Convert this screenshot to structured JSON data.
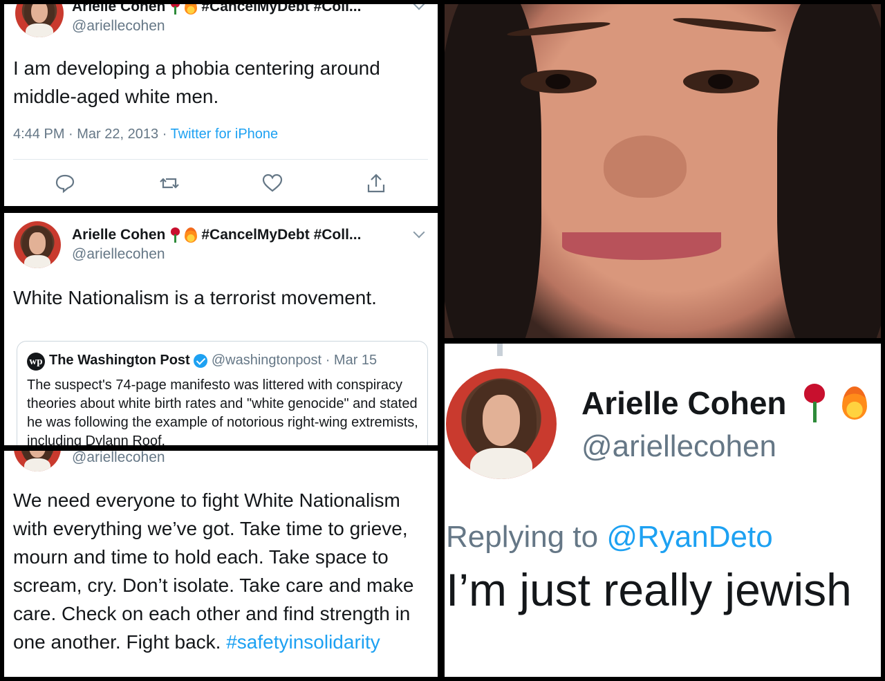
{
  "tweet1": {
    "name": "Arielle Cohen",
    "hashtags": "#CancelMyDebt #Coll...",
    "handle": "@ariellecohen",
    "text": "I am developing a phobia centering around middle-aged white men.",
    "time": "4:44 PM",
    "date": "Mar 22, 2013",
    "source": "Twitter for iPhone",
    "icons": [
      "reply-icon",
      "retweet-icon",
      "like-icon",
      "share-icon"
    ]
  },
  "tweet2": {
    "name": "Arielle Cohen",
    "hashtags": "#CancelMyDebt #Coll...",
    "handle": "@ariellecohen",
    "text": "White Nationalism is a terrorist movement.",
    "quote": {
      "logo": "wp",
      "name": "The Washington Post",
      "handle": "@washingtonpost",
      "date": "· Mar 15",
      "text": "The suspect's 74-page manifesto was littered with conspiracy theories about white birth rates and \"white genocide\" and stated he was following the example of notorious right-wing extremists, including Dylann Roof."
    }
  },
  "tweet3": {
    "handle": "@ariellecohen",
    "text": "We need everyone to fight White Nationalism with everything we’ve  got. Take time to grieve, mourn and time to hold each. Take space to scream, cry. Don’t isolate. Take care and make care. Check on each other and find strength in one another. Fight back.",
    "hashtag": "#safetyinsolidarity"
  },
  "tweet4": {
    "name": "Arielle Cohen",
    "handle": "@ariellecohen",
    "replying_prefix": "Replying to",
    "replying_to": "@RyanDeto",
    "text": "I’m just really jewish"
  },
  "colors": {
    "link": "#1da1f2",
    "muted": "#657786",
    "text": "#14171a",
    "border": "#000000"
  }
}
